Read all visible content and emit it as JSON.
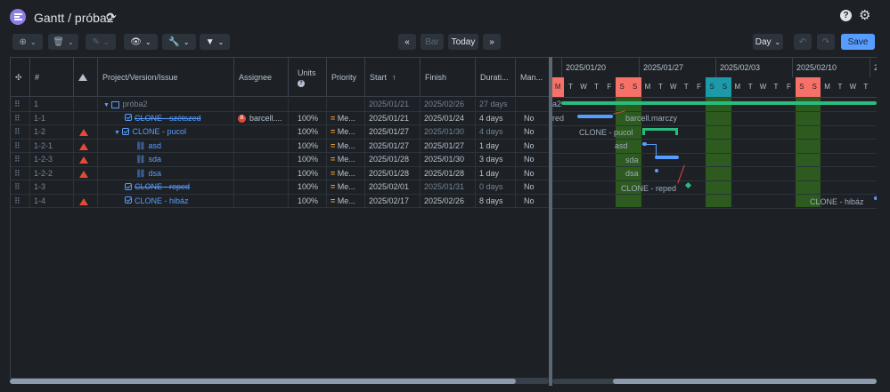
{
  "header": {
    "title": "Gantt / próba2"
  },
  "toolbar": {
    "bar_label": "Bar",
    "today_label": "Today",
    "day_label": "Day",
    "save_label": "Save",
    "prev_label": "«",
    "next_label": "»"
  },
  "columns": {
    "number": "#",
    "issue": "Project/Version/Issue",
    "assignee": "Assignee",
    "units": "Units",
    "priority": "Priority",
    "start": "Start",
    "finish": "Finish",
    "duration": "Durati...",
    "manual": "Man..."
  },
  "rows": [
    {
      "num": "1",
      "issue": "próba2",
      "assignee": "",
      "units": "",
      "priority": "",
      "start": "2025/01/21",
      "finish": "2025/02/26",
      "duration": "27 days",
      "manual": ""
    },
    {
      "num": "1-1",
      "issue": "CLONE - szétszed",
      "assignee": "barcell....",
      "avatar": "B",
      "units": "100%",
      "priority": "Me...",
      "start": "2025/01/21",
      "finish": "2025/01/24",
      "duration": "4 days",
      "manual": "No"
    },
    {
      "num": "1-2",
      "issue": "CLONE - pucol",
      "assignee": "",
      "units": "100%",
      "priority": "Me...",
      "start": "2025/01/27",
      "finish": "2025/01/30",
      "duration": "4 days",
      "manual": "No"
    },
    {
      "num": "1-2-1",
      "issue": "asd",
      "assignee": "",
      "units": "100%",
      "priority": "Me...",
      "start": "2025/01/27",
      "finish": "2025/01/27",
      "duration": "1 day",
      "manual": "No"
    },
    {
      "num": "1-2-3",
      "issue": "sda",
      "assignee": "",
      "units": "100%",
      "priority": "Me...",
      "start": "2025/01/28",
      "finish": "2025/01/30",
      "duration": "3 days",
      "manual": "No"
    },
    {
      "num": "1-2-2",
      "issue": "dsa",
      "assignee": "",
      "units": "100%",
      "priority": "Me...",
      "start": "2025/01/28",
      "finish": "2025/01/28",
      "duration": "1 day",
      "manual": "No"
    },
    {
      "num": "1-3",
      "issue": "CLONE - reped",
      "assignee": "",
      "units": "100%",
      "priority": "Me...",
      "start": "2025/02/01",
      "finish": "2025/01/31",
      "duration": "0 days",
      "manual": "No"
    },
    {
      "num": "1-4",
      "issue": "CLONE - hibáz",
      "assignee": "",
      "units": "100%",
      "priority": "Me...",
      "start": "2025/02/17",
      "finish": "2025/02/26",
      "duration": "8 days",
      "manual": "No"
    }
  ],
  "gantt": {
    "weeks": [
      "2025/01/20",
      "2025/01/27",
      "2025/02/03",
      "2025/02/10",
      "2"
    ],
    "days": [
      "M",
      "T",
      "W",
      "T",
      "F",
      "S",
      "S",
      "M",
      "T",
      "W",
      "T",
      "F",
      "S",
      "S",
      "M",
      "T",
      "W",
      "T",
      "F",
      "S",
      "S",
      "M",
      "T",
      "W",
      "T",
      "F",
      "S",
      "S"
    ],
    "bar_labels": {
      "a2": "a2",
      "red": "red",
      "assignee": "barcell.marczy",
      "pucol": "CLONE - pucol",
      "asd": "asd",
      "sda": "sda",
      "dsa": "dsa",
      "reped": "CLONE - reped",
      "hibaz": "CLONE - hibáz"
    }
  },
  "colors": {
    "accent": "#579dff",
    "save": "#579dff",
    "warning": "#e34935",
    "weekend": "#2d5a1e",
    "today": "#f87168",
    "holiday": "#1d9aaa",
    "summary": "#2abb7f"
  }
}
